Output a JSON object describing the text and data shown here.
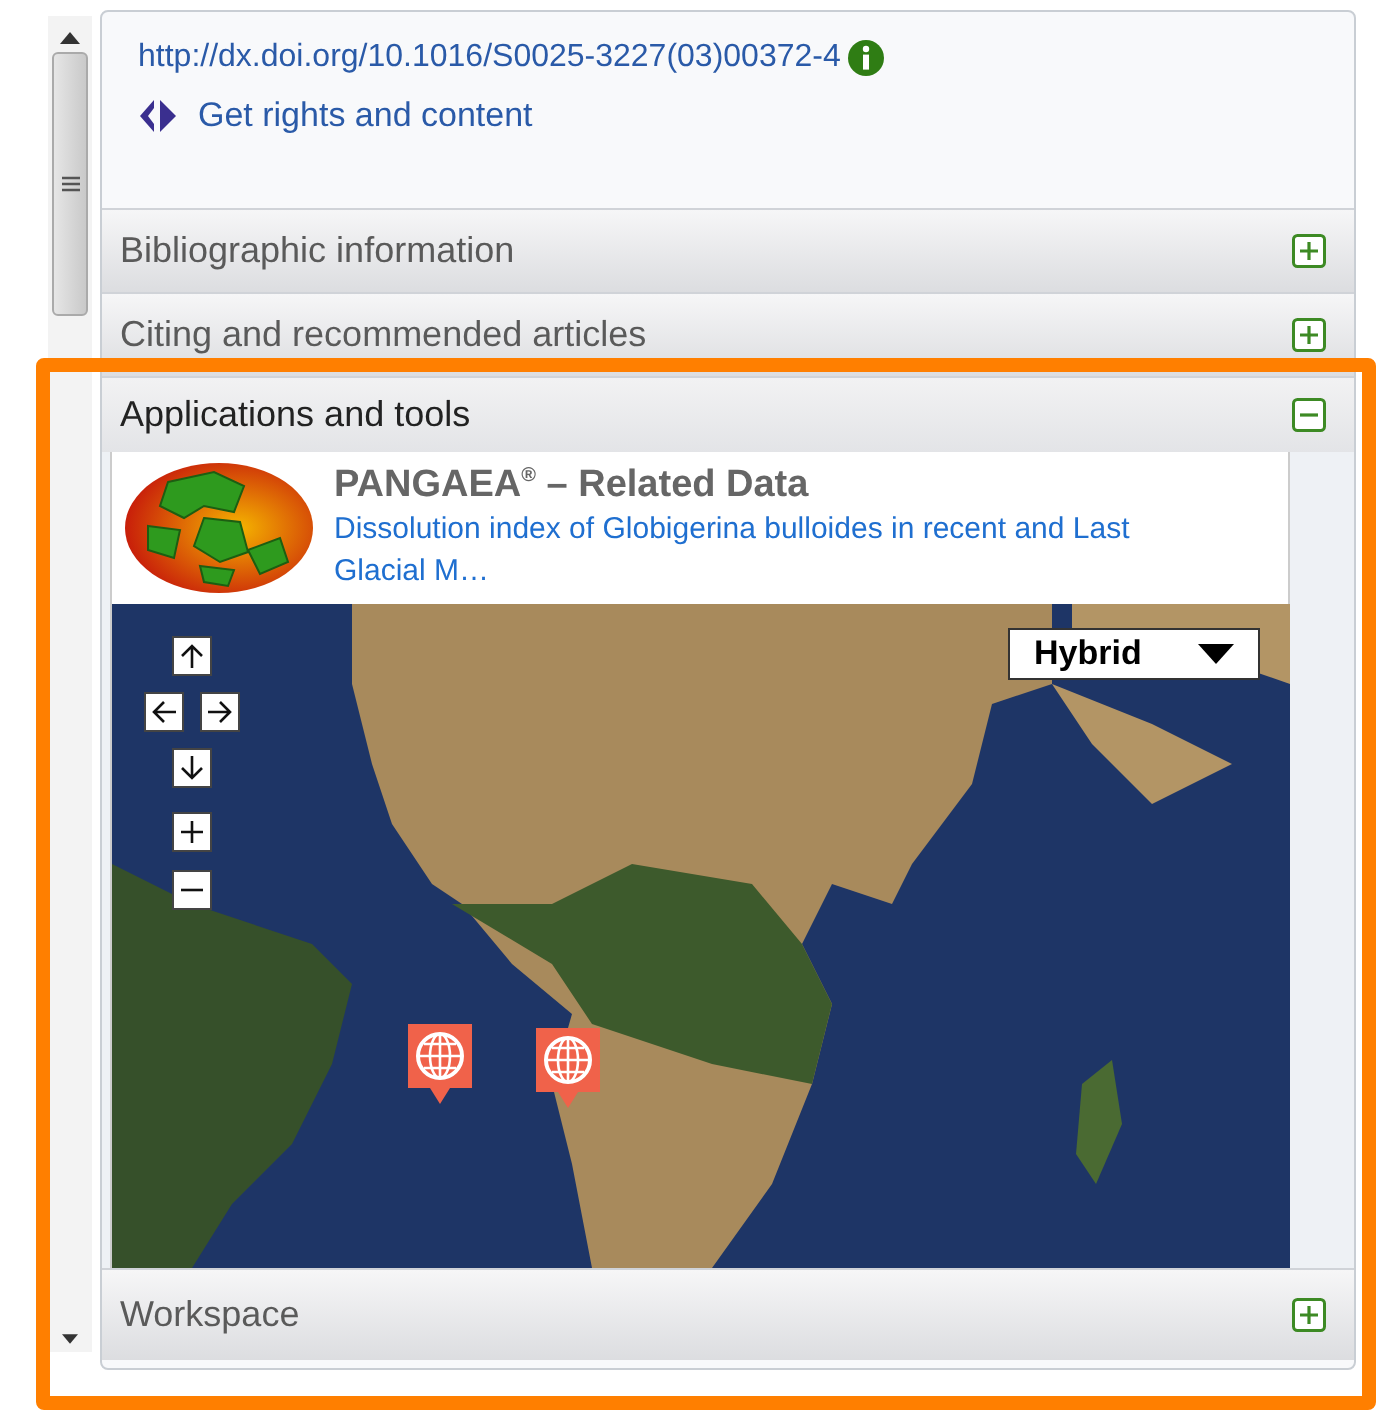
{
  "links": {
    "doi": "http://dx.doi.org/10.1016/S0025-3227(03)00372-4",
    "rights": "Get rights and content"
  },
  "sections": [
    {
      "title": "Bibliographic information",
      "expanded": false
    },
    {
      "title": "Citing and recommended articles",
      "expanded": false
    },
    {
      "title": "Applications and tools",
      "expanded": true
    },
    {
      "title": "Workspace",
      "expanded": false
    }
  ],
  "pangaea": {
    "title": "PANGAEA$^{®}$ – Related Data",
    "dataset": "Dissolution index of Globigerina bulloides in recent and Last Glacial M…"
  },
  "map": {
    "map_type": "Hybrid"
  }
}
